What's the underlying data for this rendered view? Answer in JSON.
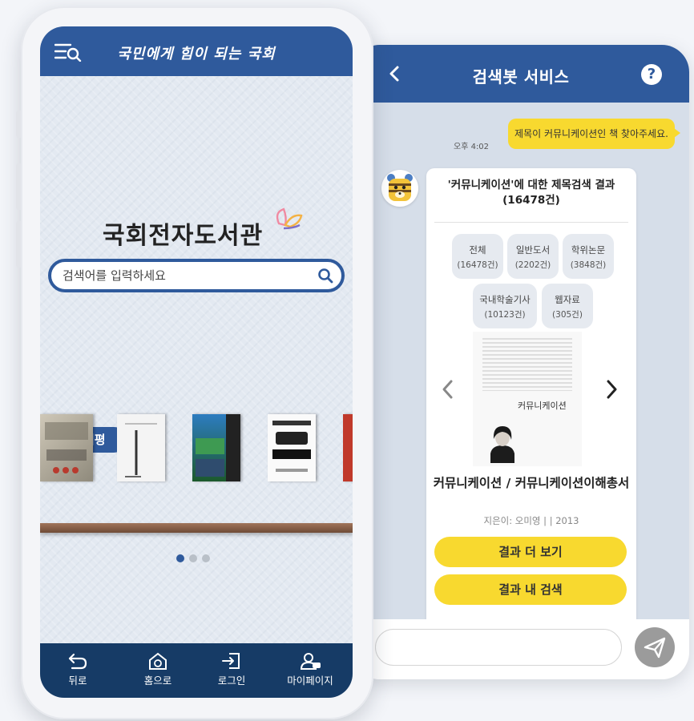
{
  "main_app": {
    "header": {
      "slogan": "국민에게 힘이 되는 국회"
    },
    "logo": {
      "title": "국회전자도서관"
    },
    "search": {
      "placeholder": "검색어를 입력하세요"
    },
    "reviews": {
      "section_label": "최신서평"
    },
    "carousel": {
      "page_count": 3,
      "active_page": 1
    },
    "bottom_nav": {
      "items": [
        {
          "label": "뒤로",
          "icon": "back-arrow-icon"
        },
        {
          "label": "홈으로",
          "icon": "home-icon"
        },
        {
          "label": "로그인",
          "icon": "login-icon"
        },
        {
          "label": "마이페이지",
          "icon": "my-page-icon"
        }
      ]
    }
  },
  "chat_app": {
    "header": {
      "title": "검색봇 서비스",
      "help_label": "?"
    },
    "messages": {
      "user_text": "제목이 커뮤니케이션인 책 찾아주세요.",
      "time": "오후 4:02"
    },
    "result": {
      "title": "'커뮤니케이션'에 대한 제목검색 결과(16478건)",
      "categories": [
        {
          "name": "전체",
          "count": "(16478건)"
        },
        {
          "name": "일반도서",
          "count": "(2202건)"
        },
        {
          "name": "학위논문",
          "count": "(3848건)"
        },
        {
          "name": "국내학술기사",
          "count": "(10123건)"
        },
        {
          "name": "웹자료",
          "count": "(305건)"
        }
      ],
      "book": {
        "cover_title": "커뮤니케이션",
        "title": "커뮤니케이션 / 커뮤니케이션이해총서",
        "meta": "지은이: 오미영 | | 2013"
      },
      "more_button": "결과 더 보기",
      "refine_button": "결과 내 검색"
    },
    "input": {
      "placeholder": ""
    }
  },
  "colors": {
    "brand_blue": "#2f5a9c",
    "nav_navy": "#163b66",
    "accent_yellow": "#f8d92f"
  }
}
